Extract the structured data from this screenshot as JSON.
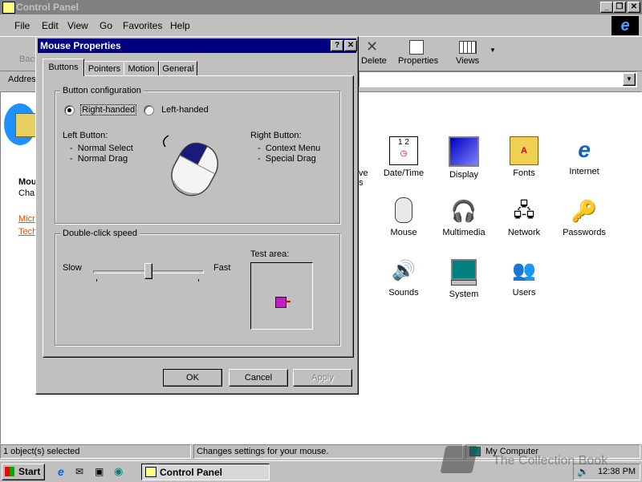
{
  "window": {
    "title": "Control Panel"
  },
  "menu": [
    "File",
    "Edit",
    "View",
    "Go",
    "Favorites",
    "Help"
  ],
  "toolbar": {
    "back": "Back",
    "delete": "Delete",
    "properties": "Properties",
    "views": "Views"
  },
  "address": {
    "label": "Address"
  },
  "left_pane": {
    "title_prefix": "Mou",
    "subtitle_prefix": "Cha",
    "link1": "Micr",
    "link2": "Tech"
  },
  "icons": [
    {
      "label": "ve"
    },
    {
      "label": "Date/Time"
    },
    {
      "label": "Display"
    },
    {
      "label": "Fonts"
    },
    {
      "label": "Internet"
    },
    {
      "label": "Mouse"
    },
    {
      "label": "Multimedia"
    },
    {
      "label": "Network"
    },
    {
      "label": "Passwords"
    },
    {
      "label": "Sounds"
    },
    {
      "label": "System"
    },
    {
      "label": "Users"
    }
  ],
  "dialog": {
    "title": "Mouse Properties",
    "tabs": [
      "Buttons",
      "Pointers",
      "Motion",
      "General"
    ],
    "button_config": {
      "title": "Button configuration",
      "right_handed": "Right-handed",
      "left_handed": "Left-handed",
      "left_button_title": "Left Button:",
      "left_items": [
        "-  Normal Select",
        "-  Normal Drag"
      ],
      "right_button_title": "Right Button:",
      "right_items": [
        "-  Context Menu",
        "-  Special Drag"
      ]
    },
    "dblclick": {
      "title": "Double-click speed",
      "slow": "Slow",
      "fast": "Fast",
      "test_area": "Test area:",
      "speed_fraction": 0.5
    },
    "ok": "OK",
    "cancel": "Cancel",
    "apply": "Apply"
  },
  "status": {
    "selected": "1 object(s) selected",
    "hint": "Changes settings for your mouse.",
    "zone": "My Computer"
  },
  "taskbar": {
    "start": "Start",
    "task": "Control Panel",
    "time": "12:38 PM"
  },
  "watermark": "The Collection Book"
}
